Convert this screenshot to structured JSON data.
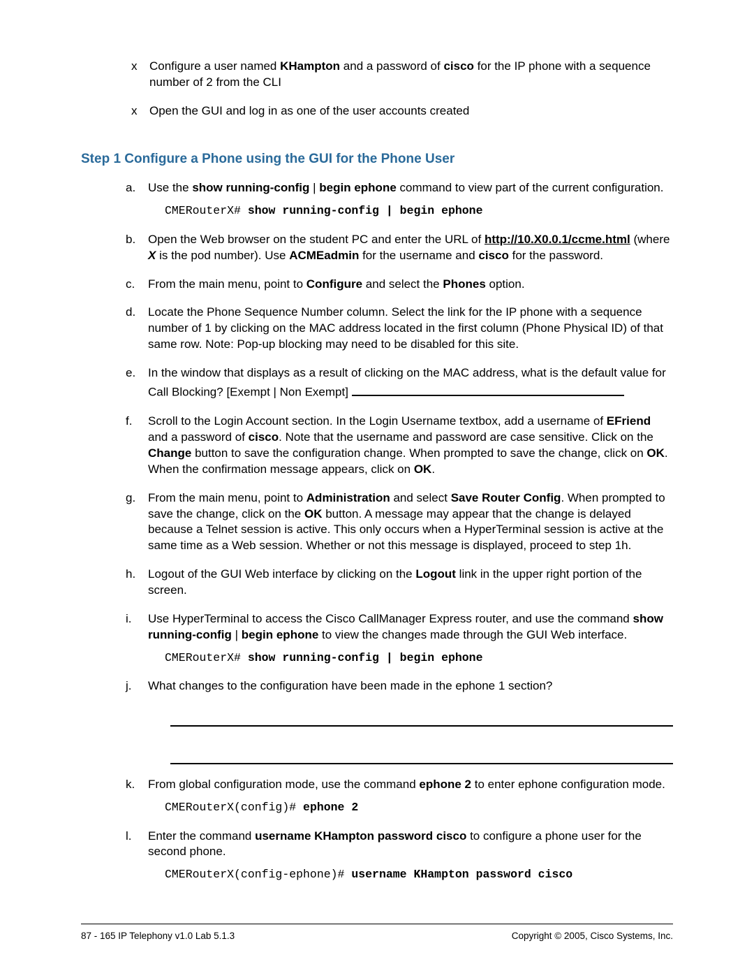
{
  "intro": {
    "items": [
      {
        "pre": "Configure a user named ",
        "b1": "KHampton",
        "mid": " and a password of ",
        "b2": "cisco",
        "post": " for the IP phone with a sequence number of 2 from the CLI"
      },
      {
        "text": "Open the GUI and log in as one of the user accounts created"
      }
    ]
  },
  "step_title": "Step 1 Configure a Phone using the GUI for the Phone User",
  "steps": {
    "a": {
      "text_pre": "Use the ",
      "b1": "show running-config",
      "pipe": " | ",
      "b2": "begin ephone",
      "text_post": " command to view part of the current configuration.",
      "code_prompt": "CMERouterX# ",
      "code_cmd": "show running-config | begin ephone"
    },
    "b": {
      "t1": "Open the Web browser on the student PC and enter the URL of ",
      "url": "http://10.X0.0.1/ccme.html",
      "t2": " (where ",
      "bx": "X",
      "t3": " is the pod number). Use ",
      "b_user": "ACMEadmin",
      "t4": " for the username and ",
      "b_pwd": "cisco",
      "t5": " for the password."
    },
    "c": {
      "t1": "From the main menu, point to ",
      "b1": "Configure",
      "t2": " and select the ",
      "b2": "Phones",
      "t3": " option."
    },
    "d": {
      "text": "Locate the Phone Sequence Number column. Select the link for the IP phone with a sequence number of 1 by clicking on the MAC address located in the first column (Phone Physical ID) of that same row. Note: Pop-up blocking may need to be disabled for this site."
    },
    "e": {
      "text": "In the window that displays as a result of clicking on the MAC address, what is the default value for Call Blocking? [Exempt | Non Exempt] "
    },
    "f": {
      "t1": "Scroll to the Login Account section. In the Login Username textbox, add a username of ",
      "b1": "EFriend",
      "t2": " and a password of ",
      "b2": "cisco",
      "t3": ". Note that the username and password are case sensitive. Click on the ",
      "b3": "Change",
      "t4": " button to save the configuration change. When prompted to save the change, click on ",
      "b4": "OK",
      "t5": ". When the confirmation message appears, click on ",
      "b5": "OK",
      "t6": "."
    },
    "g": {
      "t1": "From the main menu, point to ",
      "b1": "Administration",
      "t2": " and select ",
      "b2": "Save Router Config",
      "t3": ". When prompted to save the change, click on the ",
      "b3": "OK",
      "t4": " button. A message may appear that the change is delayed because a Telnet session is active. This only occurs when a HyperTerminal session is active at the same time as a Web session. Whether or not this message is displayed, proceed to step 1h."
    },
    "h": {
      "t1": "Logout of the GUI Web interface by clicking on the ",
      "b1": "Logout",
      "t2": " link in the upper right portion of the screen."
    },
    "i": {
      "t1": "Use HyperTerminal to access the Cisco CallManager Express router, and use the command ",
      "b1": "show running-config",
      "pipe": " | ",
      "b2": "begin ephone",
      "t2": " to view the changes made through the GUI Web interface.",
      "code_prompt": "CMERouterX# ",
      "code_cmd": "show running-config | begin ephone"
    },
    "j": {
      "text": "What changes to the configuration have been made in the ephone 1 section?"
    },
    "k": {
      "t1": "From global configuration mode, use the command ",
      "b1": "ephone 2",
      "t2": " to enter ephone configuration mode.",
      "code_prompt": "CMERouterX(config)# ",
      "code_cmd": "ephone 2"
    },
    "l": {
      "t1": "Enter the command ",
      "b1": "username KHampton password cisco",
      "t2": " to configure a phone user for the second phone.",
      "code_prompt": "CMERouterX(config-ephone)# ",
      "code_cmd": "username KHampton password cisco"
    }
  },
  "footer": {
    "left": "87 - 165   IP Telephony v1.0   Lab 5.1.3",
    "right": "Copyright © 2005, Cisco Systems, Inc."
  }
}
